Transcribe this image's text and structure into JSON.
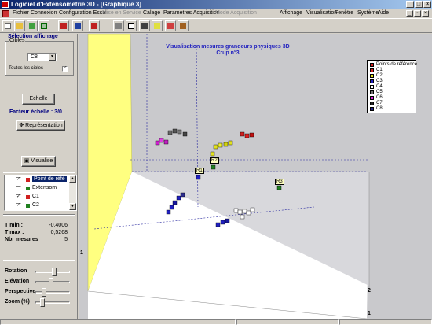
{
  "window": {
    "title": "Logiciel d'Extensometrie 3D - [Graphique 3]",
    "min_label": "_",
    "max_label": "□",
    "close_label": "×"
  },
  "menu": [
    {
      "label": "Fichier",
      "enabled": true
    },
    {
      "label": "Connexion",
      "enabled": true
    },
    {
      "label": "Configuration Essai",
      "enabled": true
    },
    {
      "label": "Mise en Service",
      "enabled": false
    },
    {
      "label": "Calage",
      "enabled": true
    },
    {
      "label": "Parametres Acquisition",
      "enabled": true
    },
    {
      "label": "Mode Acquisition",
      "enabled": false
    },
    {
      "label": "Affichage",
      "enabled": true
    },
    {
      "label": "Visualisation",
      "enabled": true
    },
    {
      "label": "Fenêtre",
      "enabled": true
    },
    {
      "label": "Système",
      "enabled": true
    },
    {
      "label": "Aide",
      "enabled": true
    }
  ],
  "toolbar": {
    "buttons": [
      "new-icon",
      "open-icon",
      "grid-icon",
      "table-icon",
      "save-icon",
      "chart-icon",
      "export-icon",
      "print-icon",
      "window-icon",
      "camera-icon",
      "help-icon",
      "tool-icon",
      "exit-icon"
    ]
  },
  "left": {
    "heading": "Sélection affichage",
    "group_label": "Cibles",
    "combo_value": "C8",
    "all_targets_label": "Toutes les cibles",
    "all_targets_checked": true,
    "scale_button": "Echelle",
    "scale_factor": "Facteur échelle : 3/0",
    "representation_button": "Représentation",
    "visualise_button": "Visualise",
    "list": [
      {
        "label": "Point de réfé",
        "checked": true,
        "color": "#d02020",
        "selected": true
      },
      {
        "label": "Extensom",
        "checked": false,
        "color": "#208020",
        "selected": false
      },
      {
        "label": "C1",
        "checked": true,
        "color": "#d02020",
        "selected": false
      },
      {
        "label": "C2",
        "checked": true,
        "color": "#208020",
        "selected": false
      }
    ],
    "stats": [
      {
        "label": "T min :",
        "value": "-0,4006"
      },
      {
        "label": "T max :",
        "value": "0,5268"
      },
      {
        "label": "Nbr mesures",
        "value": "5"
      }
    ],
    "sliders": [
      {
        "label": "Rotation",
        "level": 0.55
      },
      {
        "label": "Elévation",
        "level": 0.45
      },
      {
        "label": "Perspective",
        "level": 0.2
      },
      {
        "label": "Zoom (%)",
        "level": 0.15
      }
    ]
  },
  "view": {
    "title_line1": "Visualisation mesures grandeurs physiques 3D",
    "title_line2": "Crup n°3",
    "legend": [
      {
        "label": "Points de référence",
        "color": "#d02020"
      },
      {
        "label": "C1",
        "color": "#d02020"
      },
      {
        "label": "C2",
        "color": "#e0e020"
      },
      {
        "label": "C3",
        "color": "#2020c0"
      },
      {
        "label": "C4",
        "color": "#ffffff"
      },
      {
        "label": "C5",
        "color": "#707070"
      },
      {
        "label": "C6",
        "color": "#d020d0"
      },
      {
        "label": "C7",
        "color": "#202020"
      },
      {
        "label": "C8",
        "color": "#202080"
      }
    ],
    "point_labels": [
      "R1",
      "R2",
      "R3"
    ],
    "axis_labels": [
      "1",
      "2",
      "1"
    ]
  }
}
